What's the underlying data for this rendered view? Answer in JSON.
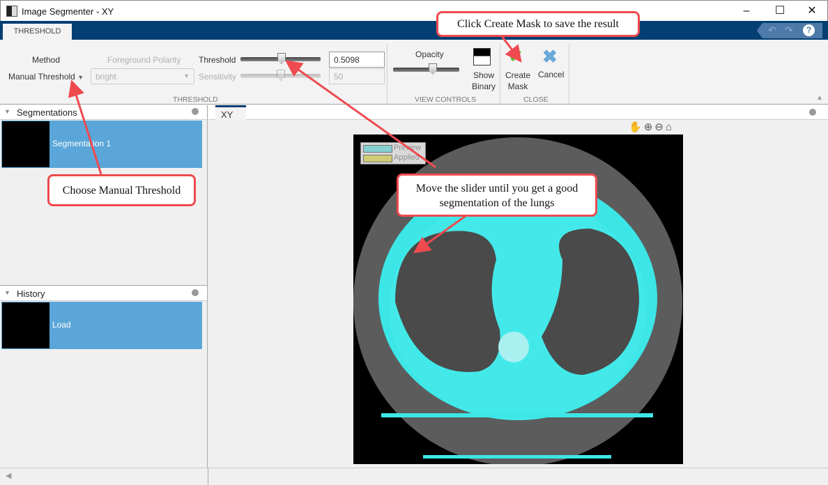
{
  "window": {
    "title": "Image Segmenter - XY",
    "controls": [
      "minimize",
      "maximize",
      "close"
    ]
  },
  "ribbon": {
    "tab": "THRESHOLD",
    "method_label": "Method",
    "method_value": "Manual Threshold",
    "polarity_label": "Foreground Polarity",
    "polarity_value": "bright",
    "threshold_label": "Threshold",
    "threshold_value": "0.5098",
    "threshold_fraction": 0.51,
    "sensitivity_label": "Sensitivity",
    "sensitivity_value": "50",
    "group_threshold": "THRESHOLD",
    "opacity_label": "Opacity",
    "opacity_fraction": 0.6,
    "show_binary": [
      "Show",
      "Binary"
    ],
    "group_view": "VIEW CONTROLS",
    "create_mask": [
      "Create",
      "Mask"
    ],
    "cancel": "Cancel",
    "group_close": "CLOSE"
  },
  "panels": {
    "segmentations": {
      "title": "Segmentations",
      "items": [
        "Segmentation 1"
      ]
    },
    "history": {
      "title": "History",
      "items": [
        "Load"
      ]
    }
  },
  "document": {
    "tab": "XY",
    "legend": [
      "Preview",
      "Applied"
    ]
  },
  "colors": {
    "ribbon": "#033f73",
    "selection": "#5aa6d8",
    "preview": "#44f0f0",
    "applied": "#f4f08a",
    "annotation": "#ef4a4f"
  },
  "annotations": {
    "create_mask": "Click Create Mask to save the result",
    "manual": "Choose Manual Threshold",
    "slider": [
      "Move the slider until you get a good",
      "segmentation of the lungs"
    ]
  }
}
